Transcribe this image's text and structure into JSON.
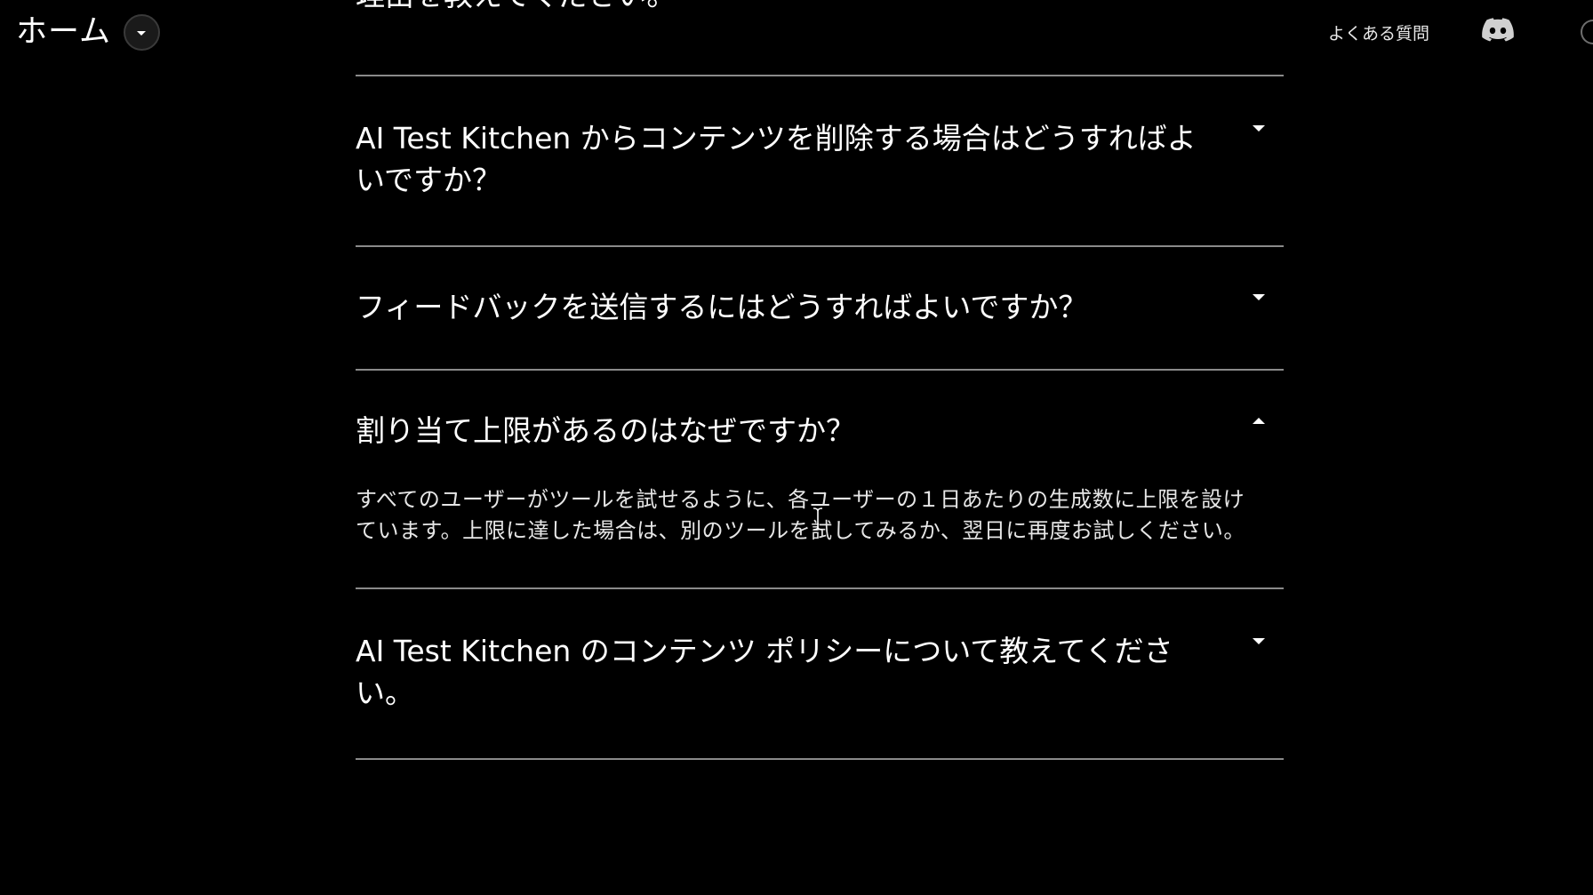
{
  "header": {
    "home_label": "ホーム",
    "faq_link": "よくある質問"
  },
  "faq": {
    "previous_question_tail": "理由を教えてください。",
    "items": [
      {
        "question": "AI Test Kitchen からコンテンツを削除する場合はどうすればよいですか？",
        "expanded": false
      },
      {
        "question": "フィードバックを送信するにはどうすればよいですか？",
        "expanded": false
      },
      {
        "question": "割り当て上限があるのはなぜですか？",
        "expanded": true,
        "answer": "すべてのユーザーがツールを試せるように、各ユーザーの１日あたりの生成数に上限を設けています。上限に達した場合は、別のツールを試してみるか、翌日に再度お試しください。"
      },
      {
        "question": "AI Test Kitchen のコンテンツ ポリシーについて教えてください。",
        "expanded": false
      }
    ]
  },
  "icons": {
    "home_dropdown": "chevron-down-icon",
    "discord": "discord-icon",
    "collapsed_toggle": "caret-down-icon",
    "expanded_toggle": "caret-up-icon",
    "cursor": "text-cursor-icon"
  },
  "colors": {
    "background": "#000000",
    "text": "#ffffff",
    "divider": "#8a8a8a"
  }
}
